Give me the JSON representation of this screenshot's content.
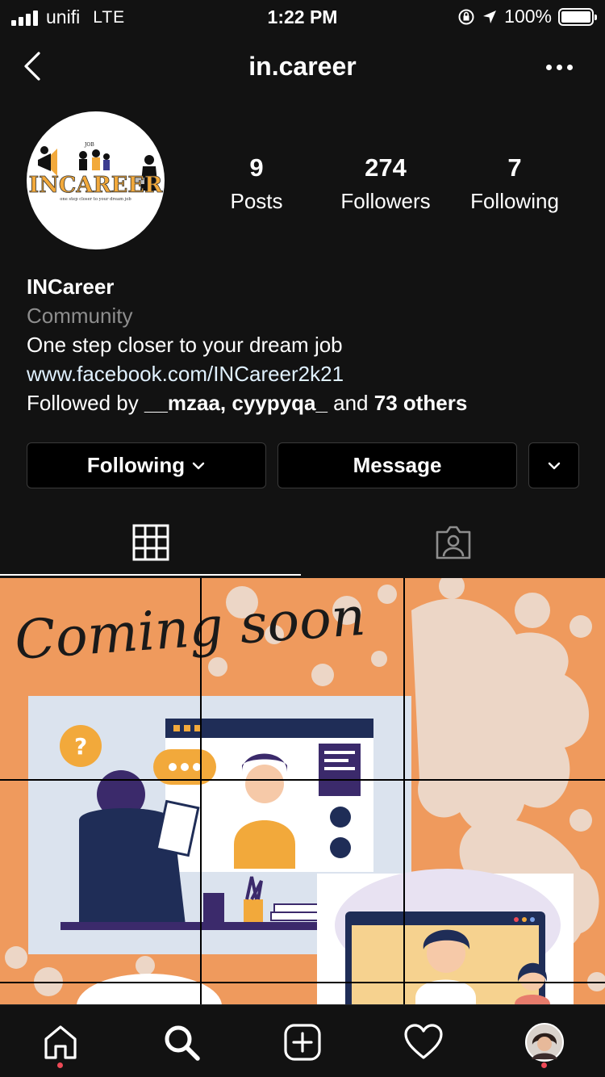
{
  "status_bar": {
    "carrier": "unifi",
    "network": "LTE",
    "time": "1:22 PM",
    "battery": "100%",
    "battery_level": 1.0
  },
  "nav": {
    "username": "in.career",
    "back_icon": "chevron-left-icon",
    "more_icon": "more-horizontal-icon"
  },
  "profile": {
    "logo_text": "INCAREER",
    "logo_tagline": "one step closer to your dream job",
    "logo_badge": "JOB",
    "stats": [
      {
        "value": "9",
        "label": "Posts"
      },
      {
        "value": "274",
        "label": "Followers"
      },
      {
        "value": "7",
        "label": "Following"
      }
    ],
    "name": "INCareer",
    "category": "Community",
    "bio": "One step closer to your dream job",
    "link": "www.facebook.com/INCareer2k21",
    "followed_by_prefix": "Followed by ",
    "followed_by_users": "__mzaa, cyypyqa_",
    "followed_by_and": " and ",
    "followed_by_others": "73 others"
  },
  "actions": {
    "following_label": "Following",
    "message_label": "Message"
  },
  "tabs": [
    {
      "name": "grid",
      "icon": "grid-icon",
      "active": true
    },
    {
      "name": "tagged",
      "icon": "tagged-person-icon",
      "active": false
    }
  ],
  "post": {
    "headline": "Coming soon"
  },
  "bottom_nav": [
    {
      "icon": "home-icon",
      "notification_dot": true
    },
    {
      "icon": "search-icon",
      "notification_dot": false
    },
    {
      "icon": "add-post-icon",
      "notification_dot": false
    },
    {
      "icon": "heart-icon",
      "notification_dot": false
    },
    {
      "icon": "profile-avatar",
      "notification_dot": true
    }
  ],
  "colors": {
    "background": "#121212",
    "post_orange": "#ef9a5d",
    "link": "#e0f1ff",
    "secondary_text": "#8e8e8e",
    "notification": "#ed4956"
  }
}
